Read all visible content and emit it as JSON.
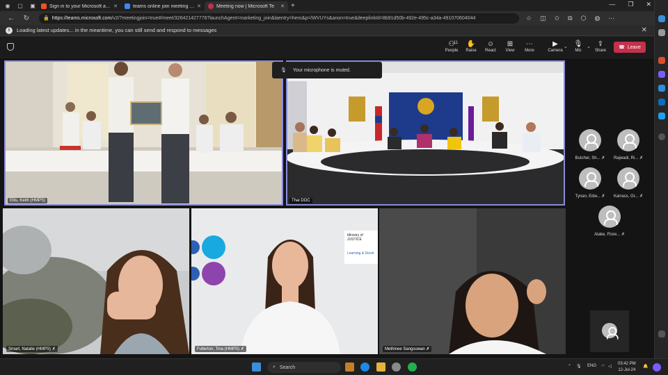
{
  "browser": {
    "tabs": [
      {
        "title": "Sign in to your Microsoft accou",
        "color": "#f25022",
        "active": false
      },
      {
        "title": "teams online join meeting - Ala",
        "color": "#4285f4",
        "active": false
      },
      {
        "title": "Meeting now | Microsoft Te",
        "color": "#6264a7",
        "active": true
      }
    ],
    "url_host": "https://teams.microsoft.com",
    "url_path": "/v2/?meetingjoin=true#/meet/326421427776?launchAgent=marketing_join&laentry=hero&p=/WVUYs&anon=true&deeplinkId=8b91d50b-492e-495c-a34a-491070604044",
    "infobar_text": "Loading latest updates... in the meantime, you can still send and respond to messages"
  },
  "meeting_toolbar": {
    "people_count": "11",
    "people_label": "People",
    "raise_label": "Raise",
    "react_label": "React",
    "view_label": "View",
    "more_label": "More",
    "camera_label": "Camera",
    "mic_label": "Mic",
    "share_label": "Share",
    "leave_label": "Leave"
  },
  "toast": "Your microphone is muted.",
  "participants": {
    "ellis": "Ellis, Keith (HMPS)",
    "thai": "Thai DOC",
    "smart": "Smart, Natalie (HMPS)",
    "fullerton": "Fullerton, Tina (HMPS)",
    "methinee": "Methinee Sangsuwan"
  },
  "side_participants": [
    "Butcher, Sh...",
    "Rajwadi, Ri...",
    "Tynan, Edw...",
    "Karrass, Gr...",
    "Alake, Flore..."
  ],
  "slide_text": {
    "ministry": "Ministry of JUSTICE",
    "learning": "Learning & Devel"
  },
  "taskbar": {
    "search_placeholder": "Search",
    "lang": "ENG",
    "time": "03:42 PM",
    "date": "12-Jul-24"
  }
}
